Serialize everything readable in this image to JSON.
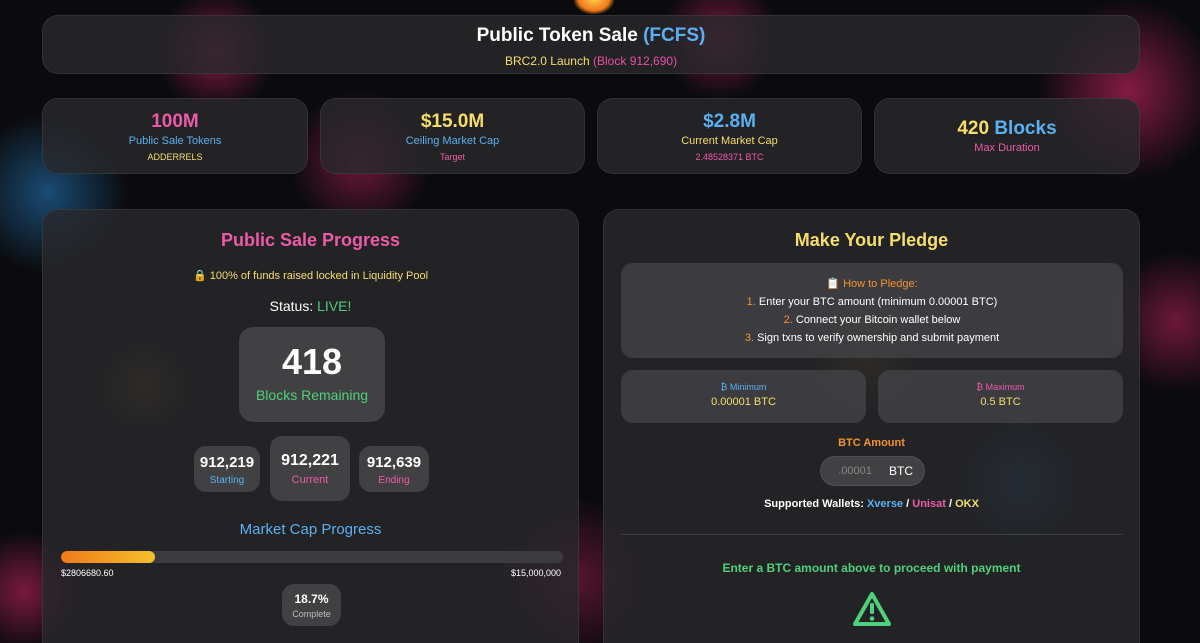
{
  "header": {
    "title_main": "Public Token Sale",
    "title_accent": "(FCFS)",
    "subtitle_main": "BRC2.0 Launch",
    "subtitle_accent": "(Block 912,690)"
  },
  "stats": [
    {
      "value": "100M",
      "label": "Public Sale Tokens",
      "sub": "ADDERRELS"
    },
    {
      "value": "$15.0M",
      "label": "Ceiling Market Cap",
      "sub": "Target"
    },
    {
      "value": "$2.8M",
      "label": "Current Market Cap",
      "sub": "2.48528371 BTC"
    },
    {
      "value_num": "420",
      "value_unit": "Blocks",
      "label": "Max Duration"
    }
  ],
  "progress": {
    "title": "Public Sale Progress",
    "lock_text": "🔒 100% of funds raised locked in Liquidity Pool",
    "status_label": "Status:",
    "status_value": "LIVE!",
    "blocks_remaining": "418",
    "blocks_remaining_label": "Blocks Remaining",
    "starting_block": "912,219",
    "starting_label": "Starting",
    "current_block": "912,221",
    "current_label": "Current",
    "ending_block": "912,639",
    "ending_label": "Ending",
    "mcap_title": "Market Cap Progress",
    "mcap_current": "$2806680.60",
    "mcap_target": "$15,000,000",
    "fill_fraction": 0.187,
    "complete_pct": "18.7%",
    "complete_label": "Complete"
  },
  "pledge": {
    "title": "Make Your Pledge",
    "howto_title": "📋 How to Pledge:",
    "steps": [
      {
        "num": "1.",
        "text": "Enter your BTC amount (minimum 0.00001 BTC)"
      },
      {
        "num": "2.",
        "text": "Connect your Bitcoin wallet below"
      },
      {
        "num": "3.",
        "text": "Sign txns to verify ownership and submit payment"
      }
    ],
    "min_label": "₿ Minimum",
    "min_value": "0.00001 BTC",
    "max_label": "₿ Maximum",
    "max_value": "0.5 BTC",
    "amount_label": "BTC Amount",
    "amount_placeholder": ".00001",
    "amount_unit": "BTC",
    "wallets_label": "Supported Wallets:",
    "wallet_1": "Xverse",
    "wallet_2": "Unisat",
    "wallet_3": "OKX",
    "sep": "/",
    "proceed_text": "Enter a BTC amount above to proceed with payment",
    "warning_icon": "warning-triangle-icon"
  },
  "colors": {
    "pink": "#ec5aa8",
    "blue": "#5ab0f0",
    "yellow": "#f5de6a",
    "green": "#4fd07a",
    "orange": "#f5932a"
  }
}
